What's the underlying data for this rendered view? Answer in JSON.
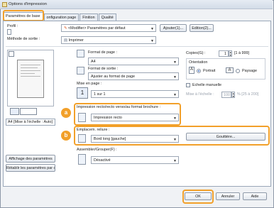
{
  "window": {
    "title": "Options d'impression"
  },
  "tabs": [
    {
      "label": "Paramètres de base"
    },
    {
      "label": "onfiguration page"
    },
    {
      "label": "Finition"
    },
    {
      "label": "Qualité"
    }
  ],
  "profile": {
    "label": "Profil :",
    "value": "<Modifier> Paramètres par défaut",
    "add_button": "Ajouter(1)...",
    "edit_button": "Edition(2)..."
  },
  "output": {
    "label": "Méthode de sortie :",
    "value": "Imprimer"
  },
  "preview": {
    "label": "A4 [Mise à l'échelle : Auto]",
    "show_settings_button": "Affichage des paramètres",
    "restore_defaults_button": "Rétablir les paramètres par défaut"
  },
  "page_size": {
    "label": "Format de page :",
    "value": "A4"
  },
  "output_size": {
    "label": "Format de sortie :",
    "value": "Ajuster au format de page"
  },
  "copies": {
    "label": "Copies(G) :",
    "value": "1",
    "range": "[1 à 999]"
  },
  "orientation": {
    "label": "Orientation",
    "portrait": "Portrait",
    "landscape": "Paysage"
  },
  "page_layout": {
    "label": "Mise en page :",
    "value": "1 sur 1"
  },
  "manual_scaling": {
    "label": "Echelle manuelle",
    "scale_label": "Mise à l'échelle :",
    "scale_value": "100",
    "scale_range": "% [25 à 200]"
  },
  "duplex": {
    "label": "Impression recto/recto verso/au format brochure :",
    "value": "Impression recto"
  },
  "binding": {
    "label": "Emplacem. reliure :",
    "value": "Bord long [gauche]",
    "gutter_button": "Gouttière..."
  },
  "collate": {
    "label": "Assembler/Grouper(F) :",
    "value": "Désactivé"
  },
  "callouts": {
    "a": "a",
    "b": "b"
  },
  "footer": {
    "ok": "OK",
    "cancel": "Annuler",
    "help": "Aide"
  },
  "colors": {
    "accent": "#f2a02a"
  }
}
